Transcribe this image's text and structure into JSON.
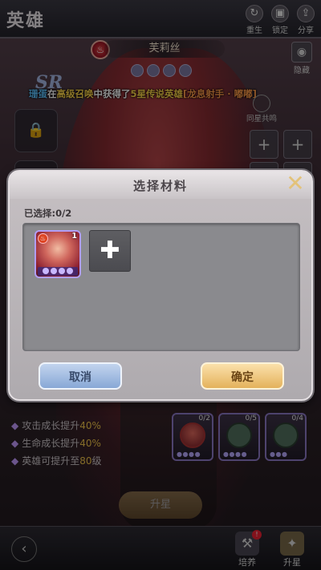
{
  "header": {
    "title": "英雄",
    "icons": [
      {
        "icon": "rebirth-icon",
        "label": "重生"
      },
      {
        "icon": "lock-icon",
        "label": "锁定"
      },
      {
        "icon": "share-icon",
        "label": "分享"
      }
    ],
    "side_button": {
      "icon": "hide-icon",
      "label": "隐藏"
    }
  },
  "hero": {
    "name": "芙莉丝",
    "rarity": "SR",
    "faction_icon": "fire-faction-icon",
    "stars": 4
  },
  "broadcast": {
    "user": "珊蛋",
    "p1": "在",
    "summon": "高级召唤",
    "p2": "中获得了",
    "star": "5星传说英雄",
    "hero": "[龙息射手 · 嘟嘟]"
  },
  "co_star": {
    "label": "同星共鸣"
  },
  "stats": [
    {
      "text": "攻击成长提升",
      "value": "40%"
    },
    {
      "text": "生命成长提升",
      "value": "40%"
    },
    {
      "text": "英雄可提升至",
      "value": "80",
      "suffix": "级"
    }
  ],
  "materials": [
    {
      "count": "0/2"
    },
    {
      "count": "0/5"
    },
    {
      "count": "0/4"
    }
  ],
  "upgrade_button": "升星",
  "bottom_tabs": [
    {
      "label": "培养",
      "icon": "train-icon",
      "badge": "!"
    },
    {
      "label": "升星",
      "icon": "star-upgrade-icon",
      "active": true
    }
  ],
  "modal": {
    "title": "选择材料",
    "selected": "已选择:0/2",
    "hero_card": {
      "count": "1",
      "stars": 4
    },
    "add_icon": "plus-icon",
    "cancel": "取消",
    "confirm": "确定"
  },
  "colors": {
    "confirm_button": "#e4b25c",
    "cancel_button": "#88a8d6",
    "card_border": "#b19ef5"
  }
}
